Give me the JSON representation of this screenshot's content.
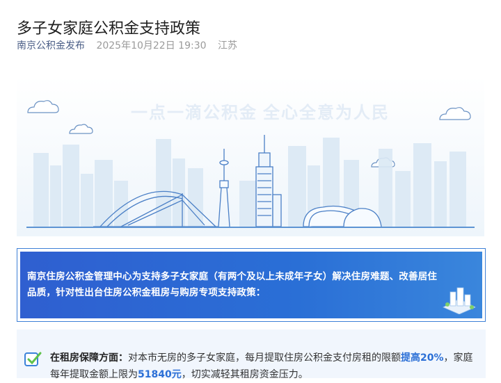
{
  "article": {
    "title": "多子女家庭公积金支持政策",
    "author": "南京公积金发布",
    "datetime": "2025年10月22日 19:30",
    "location": "江苏"
  },
  "banner": {
    "slogan": "一点一滴公积金 全心全意为人民"
  },
  "notice": {
    "text": "南京住房公积金管理中心为支持多子女家庭（有两个及以上未成年子女）解决住房难题、改善居住品质，针对性出台住房公积金租房与购房专项支持政策："
  },
  "rental_section": {
    "label": "在租房保障方面：",
    "text1": "对本市无房的多子女家庭，每月提取住房公积金支付房租的限额",
    "highlight1": "提高20%",
    "text2": "，家庭每年提取金额上限为",
    "highlight2": "51840元",
    "text3": "，切实减轻其租房资金压力。"
  },
  "colors": {
    "accent": "#2b6fd6",
    "notice_bg": "#2f5fd0",
    "section_bg": "#f1f6fd"
  }
}
